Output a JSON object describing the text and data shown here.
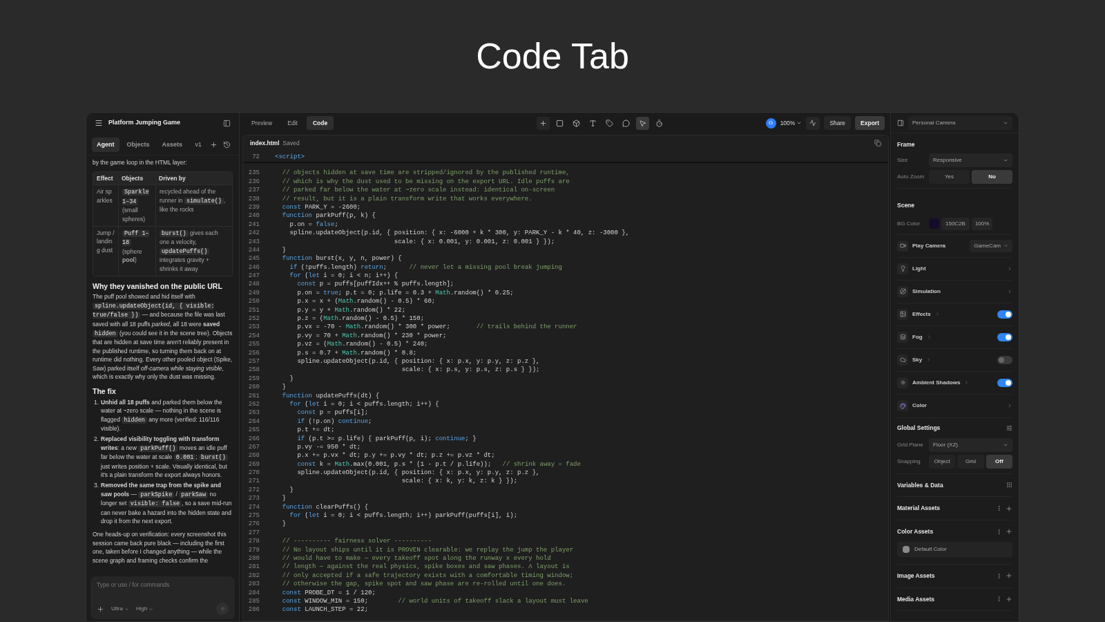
{
  "page_title": "Code Tab",
  "agent_panel": {
    "title": "Platform Jumping Game",
    "tabs": [
      {
        "label": "Agent",
        "selected": true
      },
      {
        "label": "Objects",
        "selected": false
      },
      {
        "label": "Assets",
        "selected": false
      }
    ],
    "version": "v1",
    "intro": "by the game loop in the HTML layer:",
    "table": {
      "columns": [
        "Effect",
        "Objects",
        "Driven by"
      ],
      "rows": [
        {
          "effect": "Air sparkles",
          "objects": [
            {
              "code": "Sparkle 1–34"
            },
            {
              "text": " (small spheres)"
            }
          ],
          "driven_by": [
            {
              "text": "recycled ahead of the runner in "
            },
            {
              "code": "simulate()"
            },
            {
              "text": ", like the rocks"
            }
          ]
        },
        {
          "effect": "Jump / landing dust",
          "objects": [
            {
              "code": "Puff 1–18"
            },
            {
              "text": " (sphere **pool**)"
            }
          ],
          "driven_by": [
            {
              "code": "burst()"
            },
            {
              "text": " gives each one a velocity, "
            },
            {
              "code": "updatePuffs()"
            },
            {
              "text": " integrates gravity + shrinks it away"
            }
          ]
        }
      ]
    },
    "sections": [
      {
        "heading": "Why they vanished on the public URL",
        "kind": "paragraph",
        "segments": [
          {
            "text": "The puff pool showed and hid itself with "
          },
          {
            "code": "spline.updateObject(id, { visible: true/false })"
          },
          {
            "text": " — and because the file was last saved with all 18 puffs *parked*, all 18 were **saved** "
          },
          {
            "code": "hidden"
          },
          {
            "text": " (you could see it in the scene tree). Objects that are hidden at save time aren't reliably present in the published runtime, so turning them back on at runtime did nothing. Every other pooled object (Spike, Saw) parked itself *off-camera while staying visible*, which is exactly why only the dust was missing."
          }
        ]
      },
      {
        "heading": "The fix",
        "kind": "list",
        "items": [
          {
            "number": "1.",
            "segments": [
              {
                "text": "**Unhid all 18 puffs** and parked them below the water at ~zero scale — nothing in the scene is flagged "
              },
              {
                "code": "hidden"
              },
              {
                "text": " any more (verified: 116/116 visible)."
              }
            ]
          },
          {
            "number": "2.",
            "segments": [
              {
                "text": "**Replaced visibility toggling with transform writes**: a new "
              },
              {
                "code": "parkPuff()"
              },
              {
                "text": " moves an idle puff far below the water at scale "
              },
              {
                "code": "0.001"
              },
              {
                "text": "; "
              },
              {
                "code": "burst()"
              },
              {
                "text": " just writes position + scale. Visually identical, but it's a plain transform the export always honors."
              }
            ]
          },
          {
            "number": "3.",
            "segments": [
              {
                "text": "**Removed the same trap from the spike and saw pools** — "
              },
              {
                "code": "parkSpike"
              },
              {
                "text": " / "
              },
              {
                "code": "parkSaw"
              },
              {
                "text": " no longer set "
              },
              {
                "code": "visible: false"
              },
              {
                "text": ", so a save mid-run can never bake a hazard into the hidden state and drop it from the next export."
              }
            ]
          }
        ]
      }
    ],
    "closing": "One heads-up on verification: every screenshot this session came back pure black — including the first one, taken before I changed anything — while the scene graph and framing checks confirm the",
    "composer": {
      "placeholder": "Type or use / for commands",
      "options": [
        "Ultra",
        "High"
      ]
    }
  },
  "toolbar": {
    "tabs": [
      {
        "label": "Preview",
        "selected": false
      },
      {
        "label": "Edit",
        "selected": false
      },
      {
        "label": "Code",
        "selected": true
      }
    ],
    "tools": [
      {
        "selected": false
      },
      {
        "selected": false
      },
      {
        "selected": false
      },
      {
        "selected": false
      },
      {
        "selected": false
      },
      {
        "selected": false
      },
      {
        "selected": true
      },
      {
        "selected": false
      }
    ],
    "avatar": "G",
    "zoom": "100%",
    "share": "Share",
    "export": "Export"
  },
  "editor": {
    "file": "index.html",
    "status": "Saved",
    "sticky": {
      "n": "72",
      "code": "<script>"
    },
    "lines": [
      {
        "n": "235",
        "code": "  // objects hidden at save time are stripped/ignored by the published runtime,"
      },
      {
        "n": "236",
        "code": "  // which is why the dust used to be missing on the export URL. Idle puffs are"
      },
      {
        "n": "237",
        "code": "  // parked far below the water at ~zero scale instead: identical on-screen"
      },
      {
        "n": "238",
        "code": "  // result, but it is a plain transform write that works everywhere."
      },
      {
        "n": "239",
        "code": "  const PARK_Y = -2600;"
      },
      {
        "n": "240",
        "code": "  function parkPuff(p, k) {"
      },
      {
        "n": "241",
        "code": "    p.on = false;"
      },
      {
        "n": "242",
        "code": "    spline.updateObject(p.id, { position: { x: -6000 + k * 300, y: PARK_Y - k * 40, z: -3000 },"
      },
      {
        "n": "243",
        "code": "                                scale: { x: 0.001, y: 0.001, z: 0.001 } });"
      },
      {
        "n": "244",
        "code": "  }"
      },
      {
        "n": "245",
        "code": "  function burst(x, y, n, power) {"
      },
      {
        "n": "246",
        "code": "    if (!puffs.length) return;      // never let a missing pool break jumping"
      },
      {
        "n": "247",
        "code": "    for (let i = 0; i < n; i++) {"
      },
      {
        "n": "248",
        "code": "      const p = puffs[puffIdx++ % puffs.length];"
      },
      {
        "n": "249",
        "code": "      p.on = true; p.t = 0; p.life = 0.3 + Math.random() * 0.25;"
      },
      {
        "n": "250",
        "code": "      p.x = x + (Math.random() - 0.5) * 60;"
      },
      {
        "n": "251",
        "code": "      p.y = y + Math.random() * 22;"
      },
      {
        "n": "252",
        "code": "      p.z = (Math.random() - 0.5) * 150;"
      },
      {
        "n": "253",
        "code": "      p.vx = -70 - Math.random() * 300 * power;       // trails behind the runner"
      },
      {
        "n": "254",
        "code": "      p.vy = 70 + Math.random() * 230 * power;"
      },
      {
        "n": "255",
        "code": "      p.vz = (Math.random() - 0.5) * 240;"
      },
      {
        "n": "256",
        "code": "      p.s = 0.7 + Math.random() * 0.8;"
      },
      {
        "n": "257",
        "code": "      spline.updateObject(p.id, { position: { x: p.x, y: p.y, z: p.z },"
      },
      {
        "n": "258",
        "code": "                                  scale: { x: p.s, y: p.s, z: p.s } });"
      },
      {
        "n": "259",
        "code": "    }"
      },
      {
        "n": "260",
        "code": "  }"
      },
      {
        "n": "261",
        "code": "  function updatePuffs(dt) {"
      },
      {
        "n": "262",
        "code": "    for (let i = 0; i < puffs.length; i++) {"
      },
      {
        "n": "263",
        "code": "      const p = puffs[i];"
      },
      {
        "n": "264",
        "code": "      if (!p.on) continue;"
      },
      {
        "n": "265",
        "code": "      p.t += dt;"
      },
      {
        "n": "266",
        "code": "      if (p.t >= p.life) { parkPuff(p, i); continue; }"
      },
      {
        "n": "267",
        "code": "      p.vy -= 950 * dt;"
      },
      {
        "n": "268",
        "code": "      p.x += p.vx * dt; p.y += p.vy * dt; p.z += p.vz * dt;"
      },
      {
        "n": "269",
        "code": "      const k = Math.max(0.001, p.s * (1 - p.t / p.life));   // shrink away = fade"
      },
      {
        "n": "270",
        "code": "      spline.updateObject(p.id, { position: { x: p.x, y: p.y, z: p.z },"
      },
      {
        "n": "271",
        "code": "                                  scale: { x: k, y: k, z: k } });"
      },
      {
        "n": "272",
        "code": "    }"
      },
      {
        "n": "273",
        "code": "  }"
      },
      {
        "n": "274",
        "code": "  function clearPuffs() {"
      },
      {
        "n": "275",
        "code": "    for (let i = 0; i < puffs.length; i++) parkPuff(puffs[i], i);"
      },
      {
        "n": "276",
        "code": "  }"
      },
      {
        "n": "277"
      },
      {
        "n": "278",
        "code": "  // ---------- fairness solver ----------"
      },
      {
        "n": "279",
        "code": "  // No layout ships until it is PROVEN clearable: we replay the jump the player"
      },
      {
        "n": "280",
        "code": "  // would have to make — every takeoff spot along the runway x every hold"
      },
      {
        "n": "281",
        "code": "  // length — against the real physics, spike boxes and saw phases. A layout is"
      },
      {
        "n": "282",
        "code": "  // only accepted if a safe trajectory exists with a comfortable timing window;"
      },
      {
        "n": "283",
        "code": "  // otherwise the gap, spike spot and saw phase are re-rolled until one does."
      },
      {
        "n": "284",
        "code": "  const PROBE_DT = 1 / 120;"
      },
      {
        "n": "285",
        "code": "  const WINDOW_MIN = 150;        // world units of takeoff slack a layout must leave"
      },
      {
        "n": "286",
        "code": "  const LAUNCH_STEP = 22;"
      }
    ]
  },
  "inspector": {
    "camera": "Personal Camera",
    "frame": {
      "title": "Frame",
      "size_label": "Size",
      "size": "Responsive",
      "auto_zoom_label": "Auto Zoom",
      "auto_zoom": [
        {
          "label": "Yes",
          "selected": false
        },
        {
          "label": "No",
          "selected": true
        }
      ]
    },
    "scene": {
      "title": "Scene",
      "bg_label": "BG Color",
      "bg_hex": "150C2B",
      "bg_opacity": "100%",
      "rows": [
        {
          "kind": "select",
          "label": "Play Camera",
          "value": "GameCam"
        },
        {
          "kind": "link",
          "label": "Light"
        },
        {
          "kind": "link",
          "label": "Simulation"
        },
        {
          "kind": "toggle",
          "label": "Effects",
          "on": true
        },
        {
          "kind": "toggle",
          "label": "Fog",
          "on": true
        },
        {
          "kind": "toggle",
          "label": "Sky",
          "on": false
        },
        {
          "kind": "toggle",
          "label": "Ambient Shadows",
          "on": true
        },
        {
          "kind": "link",
          "label": "Color"
        }
      ]
    },
    "global": {
      "title": "Global Settings",
      "grid_label": "Grid Plane",
      "grid": "Floor (XZ)",
      "snapping_label": "Snapping",
      "snapping": [
        {
          "label": "Object",
          "selected": false
        },
        {
          "label": "Grid",
          "selected": false
        },
        {
          "label": "Off",
          "selected": true
        }
      ]
    },
    "asset_sections": [
      {
        "title": "Variables & Data",
        "kind": "variables"
      },
      {
        "title": "Material Assets",
        "kind": "assets"
      },
      {
        "title": "Color Assets",
        "kind": "assets",
        "items": [
          {
            "label": "Default Color",
            "color": "#8a8a8a"
          }
        ]
      },
      {
        "title": "Image Assets",
        "kind": "assets"
      },
      {
        "title": "Media Assets",
        "kind": "assets"
      }
    ]
  }
}
